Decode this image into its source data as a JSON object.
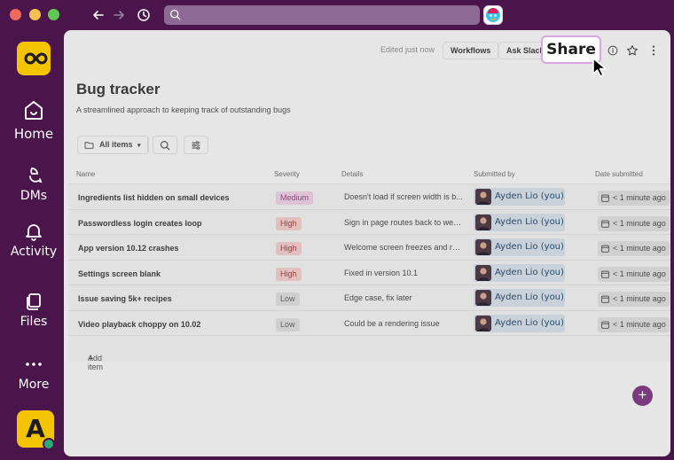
{
  "window": {
    "search_placeholder": ""
  },
  "sidebar": {
    "items": [
      {
        "label": "Home",
        "icon": "home-icon"
      },
      {
        "label": "DMs",
        "icon": "dms-icon"
      },
      {
        "label": "Activity",
        "icon": "bell-icon"
      },
      {
        "label": "Files",
        "icon": "files-icon"
      },
      {
        "label": "More",
        "icon": "more-icon"
      }
    ],
    "user_initial": "A"
  },
  "topbar": {
    "edited": "Edited just now",
    "workflows": "Workflows",
    "ask": "Ask Slackb",
    "share": "Share"
  },
  "page": {
    "title": "Bug tracker",
    "subtitle": "A streamlined approach to keeping track of outstanding bugs",
    "filter_label": "All items"
  },
  "table": {
    "columns": [
      "Name",
      "Severity",
      "Details",
      "Submitted by",
      "Date submitted"
    ],
    "rows": [
      {
        "name": "Ingredients list hidden on small devices",
        "severity": "Medium",
        "details": "Doesn't load if screen width is b...",
        "user": "Ayden Lio (you)",
        "date": "< 1 minute ago"
      },
      {
        "name": "Passwordless login creates loop",
        "severity": "High",
        "details": "Sign in page routes back to welc...",
        "user": "Ayden Lio (you)",
        "date": "< 1 minute ago"
      },
      {
        "name": "App version 10.12 crashes",
        "severity": "High",
        "details": "Welcome screen freezes and reb...",
        "user": "Ayden Lio (you)",
        "date": "< 1 minute ago"
      },
      {
        "name": "Settings screen blank",
        "severity": "High",
        "details": "Fixed in version 10.1",
        "user": "Ayden Lio (you)",
        "date": "< 1 minute ago"
      },
      {
        "name": "Issue saving 5k+ recipes",
        "severity": "Low",
        "details": "Edge case, fix later",
        "user": "Ayden Lio (you)",
        "date": "< 1 minute ago"
      },
      {
        "name": "Video playback choppy on 10.02",
        "severity": "Low",
        "details": "Could be a rendering issue",
        "user": "Ayden Lio (you)",
        "date": "< 1 minute ago"
      }
    ],
    "add_item": "Add item"
  },
  "colors": {
    "brand": "#4a154b",
    "accent": "#7c3a7e",
    "workspace": "#f5c400",
    "presence": "#2bac76"
  }
}
